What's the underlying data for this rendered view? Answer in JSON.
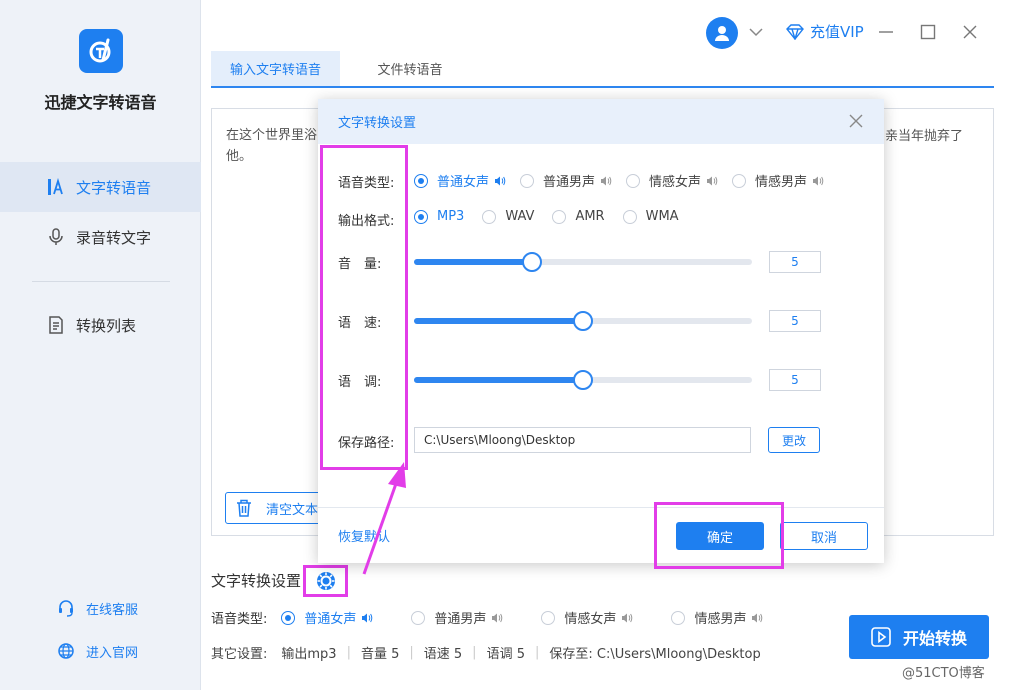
{
  "app": {
    "name": "迅捷文字转语音"
  },
  "sidebar": {
    "items": [
      {
        "label": "文字转语音"
      },
      {
        "label": "录音转文字"
      },
      {
        "label": "转换列表"
      }
    ],
    "links": [
      {
        "label": "在线客服"
      },
      {
        "label": "进入官网"
      }
    ]
  },
  "titlebar": {
    "vip_label": "充值VIP"
  },
  "tabs": [
    {
      "label": "输入文字转语音"
    },
    {
      "label": "文件转语音"
    }
  ],
  "editor": {
    "text_left_line1": "在这个世界里浴",
    "text_left_line2": "他。",
    "text_right": "亲当年抛弃了",
    "clear_label": "清空文本"
  },
  "dialog": {
    "title": "文字转换设置",
    "voice_label": "语音类型:",
    "voice_options": [
      "普通女声",
      "普通男声",
      "情感女声",
      "情感男声"
    ],
    "voice_selected": 0,
    "format_label": "输出格式:",
    "format_options": [
      "MP3",
      "WAV",
      "AMR",
      "WMA"
    ],
    "format_selected": 0,
    "volume_label": "音　量:",
    "speed_label": "语　速:",
    "pitch_label": "语　调:",
    "volume": {
      "value": "5",
      "level": 0.35
    },
    "speed": {
      "value": "5",
      "level": 0.5
    },
    "pitch": {
      "value": "5",
      "level": 0.5
    },
    "path_label": "保存路径:",
    "path_value": "C:\\Users\\Mloong\\Desktop",
    "change_label": "更改",
    "restore_label": "恢复默认",
    "ok_label": "确定",
    "cancel_label": "取消"
  },
  "bottom": {
    "settings_title": "文字转换设置",
    "voice_label": "语音类型:",
    "voice_options": [
      "普通女声",
      "普通男声",
      "情感女声",
      "情感男声"
    ],
    "other_label": "其它设置:",
    "other_items": [
      "输出mp3",
      "音量 5",
      "语速 5",
      "语调 5",
      "保存至: C:\\Users\\Mloong\\Desktop"
    ],
    "start_label": "开始转换"
  },
  "watermark": "@51CTO博客",
  "colors": {
    "accent": "#1e7ff0",
    "highlight": "#e23de8"
  }
}
